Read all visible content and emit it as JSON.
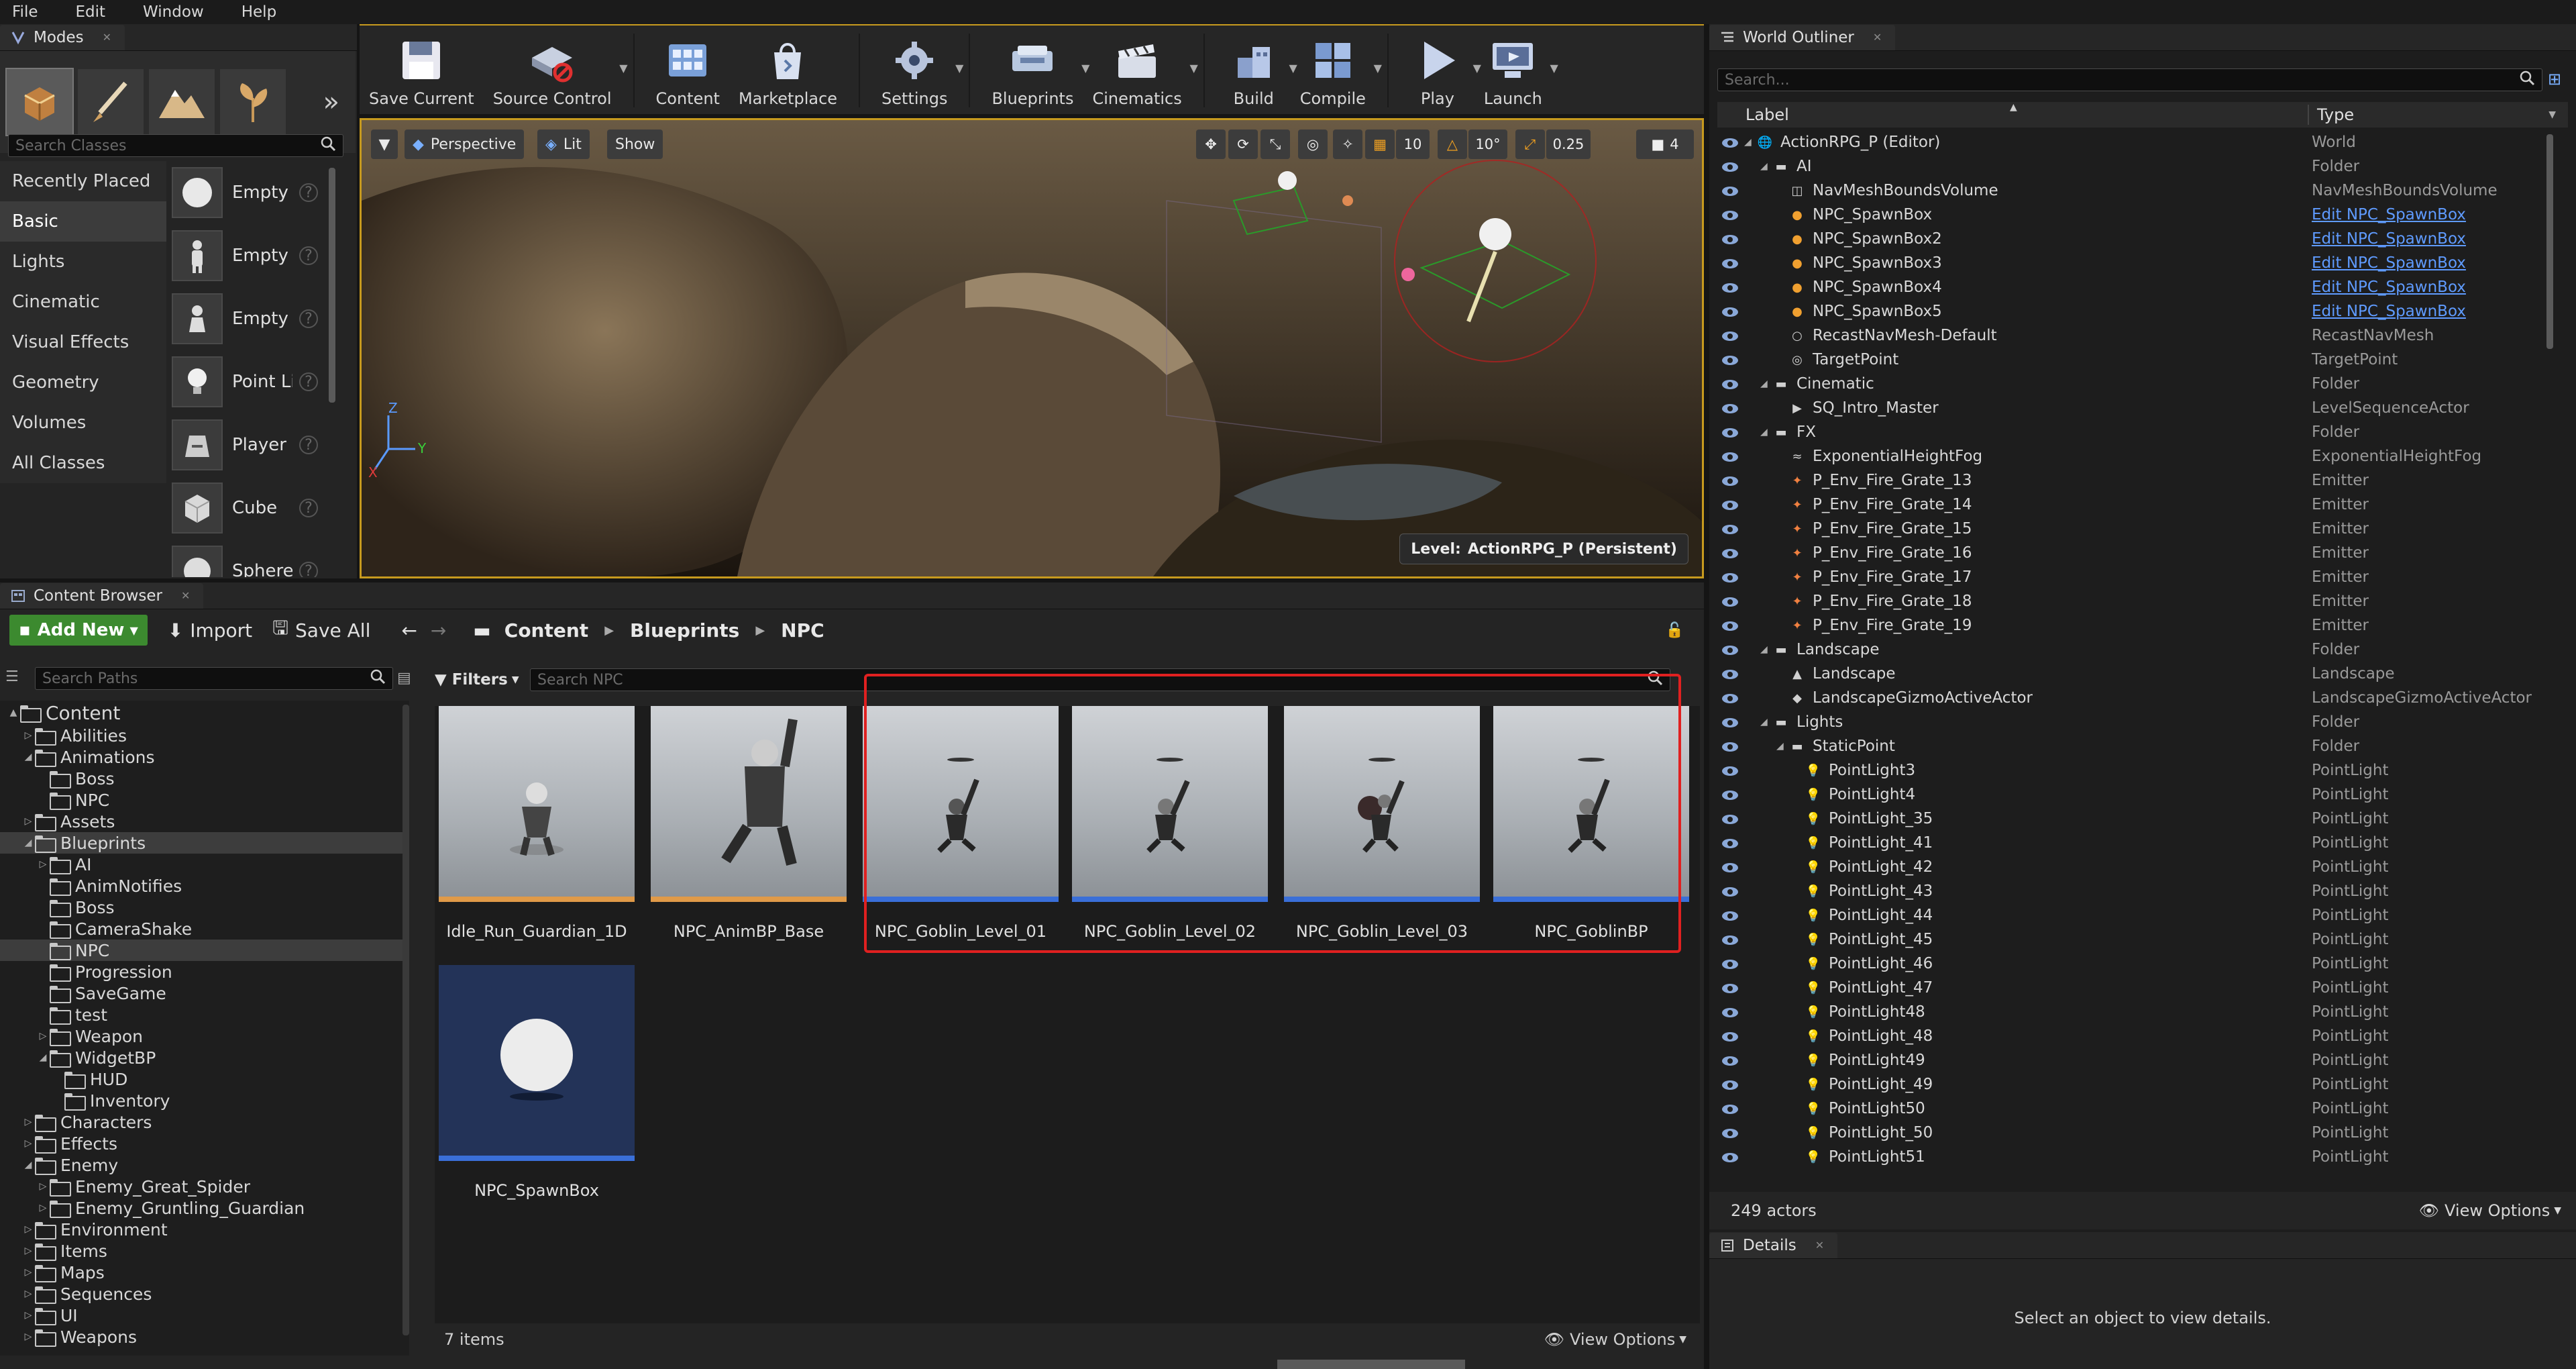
{
  "menu": [
    "File",
    "Edit",
    "Window",
    "Help"
  ],
  "modes": {
    "tab_label": "Modes",
    "search_placeholder": "Search Classes",
    "categories": [
      "Recently Placed",
      "Basic",
      "Lights",
      "Cinematic",
      "Visual Effects",
      "Geometry",
      "Volumes",
      "All Classes"
    ],
    "selected_category": "Basic",
    "items": [
      "Empty A",
      "Empty C",
      "Empty P",
      "Point Li",
      "Player S",
      "Cube",
      "Sphere"
    ]
  },
  "toolbar": {
    "buttons": [
      {
        "label": "Save Current",
        "icon": "save-icon"
      },
      {
        "label": "Source Control",
        "icon": "source-control-icon"
      },
      {
        "label": "Content",
        "icon": "content-icon"
      },
      {
        "label": "Marketplace",
        "icon": "marketplace-icon"
      },
      {
        "label": "Settings",
        "icon": "settings-icon"
      },
      {
        "label": "Blueprints",
        "icon": "blueprints-icon"
      },
      {
        "label": "Cinematics",
        "icon": "cinematics-icon"
      },
      {
        "label": "Build",
        "icon": "build-icon"
      },
      {
        "label": "Compile",
        "icon": "compile-icon"
      },
      {
        "label": "Play",
        "icon": "play-icon"
      },
      {
        "label": "Launch",
        "icon": "launch-icon"
      }
    ]
  },
  "viewport": {
    "perspective": "Perspective",
    "lit": "Lit",
    "show": "Show",
    "grid_snap": "10",
    "rotate_snap": "10°",
    "scale_snap": "0.25",
    "camera_speed": "4",
    "level_label": "Level:",
    "level_name": "ActionRPG_P (Persistent)"
  },
  "content_browser": {
    "tab_label": "Content Browser",
    "add_new": "Add New",
    "import": "Import",
    "save_all": "Save All",
    "breadcrumb": [
      "Content",
      "Blueprints",
      "NPC"
    ],
    "search_paths_placeholder": "Search Paths",
    "filters": "Filters",
    "search_placeholder": "Search NPC",
    "tree": [
      {
        "label": "Content",
        "depth": 0,
        "arrow": "▲"
      },
      {
        "label": "Abilities",
        "depth": 1,
        "arrow": "▷"
      },
      {
        "label": "Animations",
        "depth": 1,
        "arrow": "◢"
      },
      {
        "label": "Boss",
        "depth": 2,
        "arrow": ""
      },
      {
        "label": "NPC",
        "depth": 2,
        "arrow": ""
      },
      {
        "label": "Assets",
        "depth": 1,
        "arrow": "▷"
      },
      {
        "label": "Blueprints",
        "depth": 1,
        "arrow": "◢",
        "selected": true
      },
      {
        "label": "AI",
        "depth": 2,
        "arrow": "▷"
      },
      {
        "label": "AnimNotifies",
        "depth": 2,
        "arrow": ""
      },
      {
        "label": "Boss",
        "depth": 2,
        "arrow": ""
      },
      {
        "label": "CameraShake",
        "depth": 2,
        "arrow": ""
      },
      {
        "label": "NPC",
        "depth": 2,
        "arrow": "",
        "selected": true
      },
      {
        "label": "Progression",
        "depth": 2,
        "arrow": ""
      },
      {
        "label": "SaveGame",
        "depth": 2,
        "arrow": ""
      },
      {
        "label": "test",
        "depth": 2,
        "arrow": ""
      },
      {
        "label": "Weapon",
        "depth": 2,
        "arrow": "▷"
      },
      {
        "label": "WidgetBP",
        "depth": 2,
        "arrow": "◢"
      },
      {
        "label": "HUD",
        "depth": 3,
        "arrow": ""
      },
      {
        "label": "Inventory",
        "depth": 3,
        "arrow": ""
      },
      {
        "label": "Characters",
        "depth": 1,
        "arrow": "▷"
      },
      {
        "label": "Effects",
        "depth": 1,
        "arrow": "▷"
      },
      {
        "label": "Enemy",
        "depth": 1,
        "arrow": "◢"
      },
      {
        "label": "Enemy_Great_Spider",
        "depth": 2,
        "arrow": "▷"
      },
      {
        "label": "Enemy_Gruntling_Guardian",
        "depth": 2,
        "arrow": "▷"
      },
      {
        "label": "Environment",
        "depth": 1,
        "arrow": "▷"
      },
      {
        "label": "Items",
        "depth": 1,
        "arrow": "▷"
      },
      {
        "label": "Maps",
        "depth": 1,
        "arrow": "▷"
      },
      {
        "label": "Sequences",
        "depth": 1,
        "arrow": "▷"
      },
      {
        "label": "UI",
        "depth": 1,
        "arrow": "▷"
      },
      {
        "label": "Weapons",
        "depth": 1,
        "arrow": "▷"
      }
    ],
    "assets": [
      {
        "name": "Idle_Run_Guardian_1D",
        "bar": "#e09a48"
      },
      {
        "name": "NPC_AnimBP_Base",
        "bar": "#e09a48"
      },
      {
        "name": "NPC_Goblin_Level_01",
        "bar": "#3a6fd8"
      },
      {
        "name": "NPC_Goblin_Level_02",
        "bar": "#3a6fd8"
      },
      {
        "name": "NPC_Goblin_Level_03",
        "bar": "#3a6fd8"
      },
      {
        "name": "NPC_GoblinBP",
        "bar": "#3a6fd8"
      },
      {
        "name": "NPC_SpawnBox",
        "bar": "#3a6fd8"
      }
    ],
    "item_count": "7 items",
    "view_options": "View Options"
  },
  "outliner": {
    "tab_label": "World Outliner",
    "search_placeholder": "Search...",
    "col_label": "Label",
    "col_type": "Type",
    "rows": [
      {
        "label": "ActionRPG_P (Editor)",
        "type": "World",
        "depth": 0,
        "arrow": "◢",
        "icon": "world-icon"
      },
      {
        "label": "AI",
        "type": "Folder",
        "depth": 1,
        "arrow": "◢",
        "icon": "folder-icon"
      },
      {
        "label": "NavMeshBoundsVolume",
        "type": "NavMeshBoundsVolume",
        "depth": 2,
        "icon": "navmesh-icon"
      },
      {
        "label": "NPC_SpawnBox",
        "type": "Edit NPC_SpawnBox",
        "link": true,
        "depth": 2,
        "icon": "actor-icon"
      },
      {
        "label": "NPC_SpawnBox2",
        "type": "Edit NPC_SpawnBox",
        "link": true,
        "depth": 2,
        "icon": "actor-icon"
      },
      {
        "label": "NPC_SpawnBox3",
        "type": "Edit NPC_SpawnBox",
        "link": true,
        "depth": 2,
        "icon": "actor-icon"
      },
      {
        "label": "NPC_SpawnBox4",
        "type": "Edit NPC_SpawnBox",
        "link": true,
        "depth": 2,
        "icon": "actor-icon"
      },
      {
        "label": "NPC_SpawnBox5",
        "type": "Edit NPC_SpawnBox",
        "link": true,
        "depth": 2,
        "icon": "actor-icon"
      },
      {
        "label": "RecastNavMesh-Default",
        "type": "RecastNavMesh",
        "depth": 2,
        "icon": "sphere-icon"
      },
      {
        "label": "TargetPoint",
        "type": "TargetPoint",
        "depth": 2,
        "icon": "target-icon"
      },
      {
        "label": "Cinematic",
        "type": "Folder",
        "depth": 1,
        "arrow": "◢",
        "icon": "folder-icon"
      },
      {
        "label": "SQ_Intro_Master",
        "type": "LevelSequenceActor",
        "depth": 2,
        "icon": "sequence-icon"
      },
      {
        "label": "FX",
        "type": "Folder",
        "depth": 1,
        "arrow": "◢",
        "icon": "folder-icon"
      },
      {
        "label": "ExponentialHeightFog",
        "type": "ExponentialHeightFog",
        "depth": 2,
        "icon": "fog-icon"
      },
      {
        "label": "P_Env_Fire_Grate_13",
        "type": "Emitter",
        "depth": 2,
        "icon": "emitter-icon"
      },
      {
        "label": "P_Env_Fire_Grate_14",
        "type": "Emitter",
        "depth": 2,
        "icon": "emitter-icon"
      },
      {
        "label": "P_Env_Fire_Grate_15",
        "type": "Emitter",
        "depth": 2,
        "icon": "emitter-icon"
      },
      {
        "label": "P_Env_Fire_Grate_16",
        "type": "Emitter",
        "depth": 2,
        "icon": "emitter-icon"
      },
      {
        "label": "P_Env_Fire_Grate_17",
        "type": "Emitter",
        "depth": 2,
        "icon": "emitter-icon"
      },
      {
        "label": "P_Env_Fire_Grate_18",
        "type": "Emitter",
        "depth": 2,
        "icon": "emitter-icon"
      },
      {
        "label": "P_Env_Fire_Grate_19",
        "type": "Emitter",
        "depth": 2,
        "icon": "emitter-icon"
      },
      {
        "label": "Landscape",
        "type": "Folder",
        "depth": 1,
        "arrow": "◢",
        "icon": "folder-icon"
      },
      {
        "label": "Landscape",
        "type": "Landscape",
        "depth": 2,
        "icon": "landscape-icon"
      },
      {
        "label": "LandscapeGizmoActiveActor",
        "type": "LandscapeGizmoActiveActor",
        "depth": 2,
        "icon": "gizmo-icon"
      },
      {
        "label": "Lights",
        "type": "Folder",
        "depth": 1,
        "arrow": "◢",
        "icon": "folder-icon"
      },
      {
        "label": "StaticPoint",
        "type": "Folder",
        "depth": 2,
        "arrow": "◢",
        "icon": "folder-icon"
      },
      {
        "label": "PointLight3",
        "type": "PointLight",
        "depth": 3,
        "icon": "pointlight-icon"
      },
      {
        "label": "PointLight4",
        "type": "PointLight",
        "depth": 3,
        "icon": "pointlight-icon"
      },
      {
        "label": "PointLight_35",
        "type": "PointLight",
        "depth": 3,
        "icon": "pointlight-icon"
      },
      {
        "label": "PointLight_41",
        "type": "PointLight",
        "depth": 3,
        "icon": "pointlight-icon"
      },
      {
        "label": "PointLight_42",
        "type": "PointLight",
        "depth": 3,
        "icon": "pointlight-icon"
      },
      {
        "label": "PointLight_43",
        "type": "PointLight",
        "depth": 3,
        "icon": "pointlight-icon"
      },
      {
        "label": "PointLight_44",
        "type": "PointLight",
        "depth": 3,
        "icon": "pointlight-icon"
      },
      {
        "label": "PointLight_45",
        "type": "PointLight",
        "depth": 3,
        "icon": "pointlight-icon"
      },
      {
        "label": "PointLight_46",
        "type": "PointLight",
        "depth": 3,
        "icon": "pointlight-icon"
      },
      {
        "label": "PointLight_47",
        "type": "PointLight",
        "depth": 3,
        "icon": "pointlight-icon"
      },
      {
        "label": "PointLight48",
        "type": "PointLight",
        "depth": 3,
        "icon": "pointlight-icon"
      },
      {
        "label": "PointLight_48",
        "type": "PointLight",
        "depth": 3,
        "icon": "pointlight-icon"
      },
      {
        "label": "PointLight49",
        "type": "PointLight",
        "depth": 3,
        "icon": "pointlight-icon"
      },
      {
        "label": "PointLight_49",
        "type": "PointLight",
        "depth": 3,
        "icon": "pointlight-icon"
      },
      {
        "label": "PointLight50",
        "type": "PointLight",
        "depth": 3,
        "icon": "pointlight-icon"
      },
      {
        "label": "PointLight_50",
        "type": "PointLight",
        "depth": 3,
        "icon": "pointlight-icon"
      },
      {
        "label": "PointLight51",
        "type": "PointLight",
        "depth": 3,
        "icon": "pointlight-icon"
      }
    ],
    "actor_count": "249 actors",
    "view_options": "View Options"
  },
  "details": {
    "tab_label": "Details",
    "empty_message": "Select an object to view details."
  },
  "colors": {
    "accent": "#c79a1e",
    "selection_box": "#e02020",
    "add_new": "#3c8a2f",
    "link": "#5f9bff"
  }
}
